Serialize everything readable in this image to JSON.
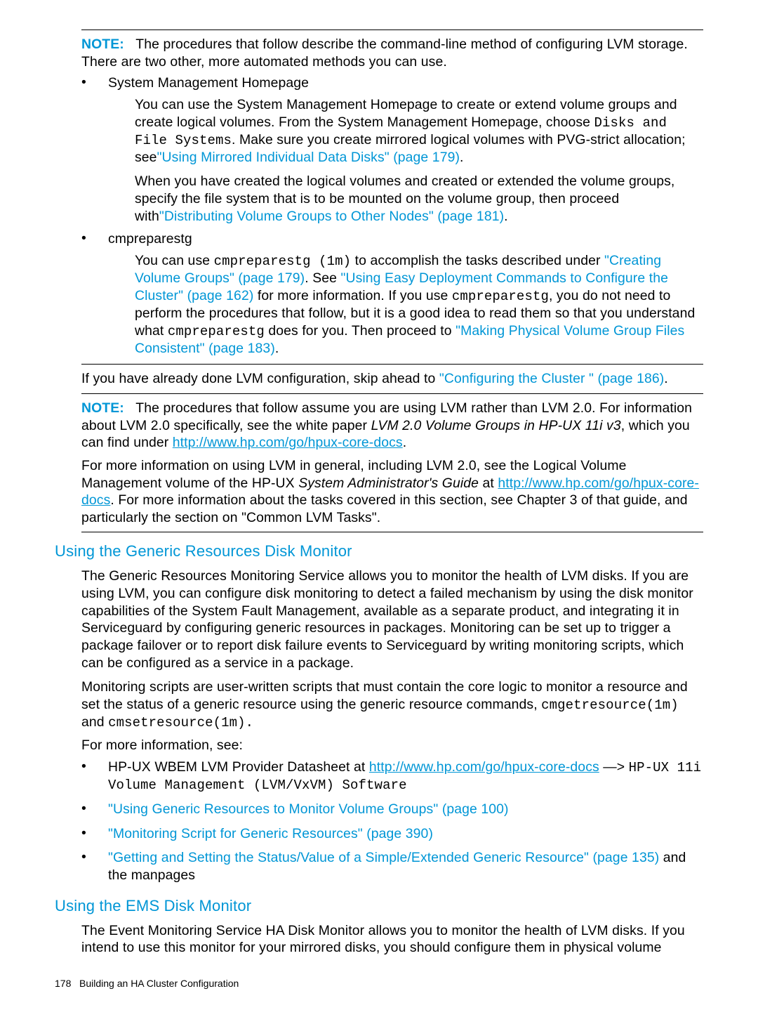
{
  "note1": {
    "label": "NOTE:",
    "text": "The procedures that follow describe the command-line method of configuring LVM storage. There are two other, more automated methods you can use."
  },
  "bullets1": {
    "item1_title": "System Management Homepage",
    "item1_p1_a": "You can use the System Management Homepage to create or extend volume groups and create logical volumes. From the System Management Homepage, choose ",
    "item1_p1_code": "Disks and File Systems",
    "item1_p1_b": ". Make sure you create mirrored logical volumes with PVG-strict allocation; see",
    "item1_p1_link": "\"Using Mirrored Individual Data Disks\" (page 179)",
    "item1_p1_c": ".",
    "item1_p2_a": "When you have created the logical volumes and created or extended the volume groups, specify the file system that is to be mounted on the volume group, then proceed with",
    "item1_p2_link": "\"Distributing Volume Groups to Other Nodes\" (page 181)",
    "item1_p2_b": ".",
    "item2_title": "cmpreparestg",
    "item2_p1_a": "You can use ",
    "item2_p1_code1": "cmpreparestg (1m)",
    "item2_p1_b": " to accomplish the tasks described under ",
    "item2_p1_link1": "\"Creating Volume Groups\" (page 179)",
    "item2_p1_c": ". See ",
    "item2_p1_link2": "\"Using Easy Deployment Commands to Configure the Cluster\" (page 162)",
    "item2_p1_d": " for more information. If you use ",
    "item2_p1_code2": "cmpreparestg",
    "item2_p1_e": ", you do not need to perform the procedures that follow, but it is a good idea to read them so that you understand what ",
    "item2_p1_code3": "cmpreparestg",
    "item2_p1_f": " does for you. Then proceed to ",
    "item2_p1_link3": "\"Making Physical Volume Group Files Consistent\" (page 183)",
    "item2_p1_g": "."
  },
  "skip": {
    "a": "If you have already done LVM configuration, skip ahead to ",
    "link": "\"Configuring the Cluster \" (page 186)",
    "b": "."
  },
  "note2": {
    "label": "NOTE:",
    "p1_a": "The procedures that follow assume you are using LVM rather than LVM 2.0. For information about LVM 2.0 specifically, see the white paper ",
    "p1_italic": "LVM 2.0 Volume Groups in HP-UX 11i v3",
    "p1_b": ", which you can find under ",
    "p1_link": "http://www.hp.com/go/hpux-core-docs",
    "p1_c": ".",
    "p2_a": "For more information on using LVM in general, including LVM 2.0, see the Logical Volume Management volume of the HP-UX ",
    "p2_italic": "System Administrator's Guide",
    "p2_b": " at ",
    "p2_link": "http://www.hp.com/go/hpux-core-docs",
    "p2_c": ". For more information about the tasks covered in this section, see Chapter 3 of that guide, and particularly the section on \"Common LVM Tasks\"."
  },
  "sec1": {
    "heading": "Using the Generic Resources Disk Monitor",
    "p1": "The Generic Resources Monitoring Service allows you to monitor the health of LVM disks. If you are using LVM, you can configure disk monitoring to detect a failed mechanism by using the disk monitor capabilities of the System Fault Management, available as a separate product, and integrating it in Serviceguard by configuring generic resources in packages. Monitoring can be set up to trigger a package failover or to report disk failure events to Serviceguard by writing monitoring scripts, which can be configured as a service in a package.",
    "p2_a": "Monitoring scripts are user-written scripts that must contain the core logic to monitor a resource and set the status of a generic resource using the generic resource commands, ",
    "p2_code1": "cmgetresource(1m)",
    "p2_mid": " and ",
    "p2_code2": "cmsetresource(1m).",
    "p3": "For more information, see:",
    "b1_a": "HP-UX WBEM LVM Provider Datasheet at ",
    "b1_link": "http://www.hp.com/go/hpux-core-docs",
    "b1_b": "  —> ",
    "b1_code": "HP-UX 11i Volume Management (LVM/VxVM) Software",
    "b2": "\"Using Generic Resources to Monitor Volume Groups\" (page 100)",
    "b3": "\"Monitoring Script for Generic Resources\" (page 390)",
    "b4": "\"Getting and Setting the Status/Value of a Simple/Extended Generic Resource\" (page 135)",
    "b4_tail": " and the manpages"
  },
  "sec2": {
    "heading": "Using the EMS Disk Monitor",
    "p1": "The Event Monitoring Service HA Disk Monitor allows you to monitor the health of LVM disks. If you intend to use this monitor for your mirrored disks, you should configure them in physical volume"
  },
  "footer": {
    "page": "178",
    "title": "Building an HA Cluster Configuration"
  }
}
